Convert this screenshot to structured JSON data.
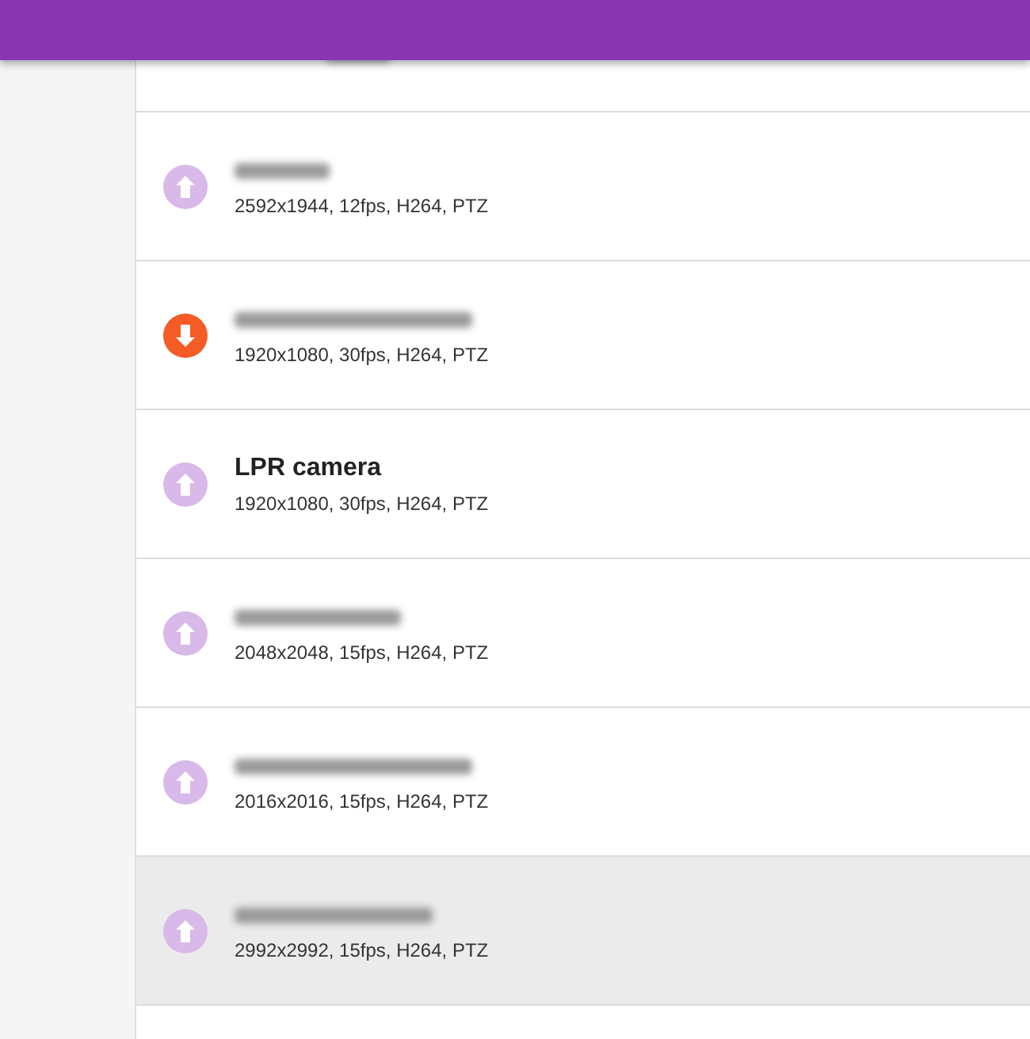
{
  "cameras": [
    {
      "title_blurred": true,
      "kind": "up",
      "specs": "2592x1944, 12fps, H264, PTZ",
      "selected": false
    },
    {
      "title_blurred": true,
      "kind": "down",
      "specs": "1920x1080, 30fps, H264, PTZ",
      "selected": false
    },
    {
      "title": "LPR camera",
      "kind": "up",
      "specs": "1920x1080, 30fps, H264, PTZ",
      "selected": false
    },
    {
      "title_blurred": true,
      "kind": "up",
      "specs": "2048x2048, 15fps, H264, PTZ",
      "selected": false
    },
    {
      "title_blurred": true,
      "kind": "up",
      "specs": "2016x2016, 15fps, H264, PTZ",
      "selected": false
    },
    {
      "title_blurred": true,
      "kind": "up",
      "specs": "2992x2992, 15fps, H264, PTZ",
      "selected": true
    }
  ]
}
